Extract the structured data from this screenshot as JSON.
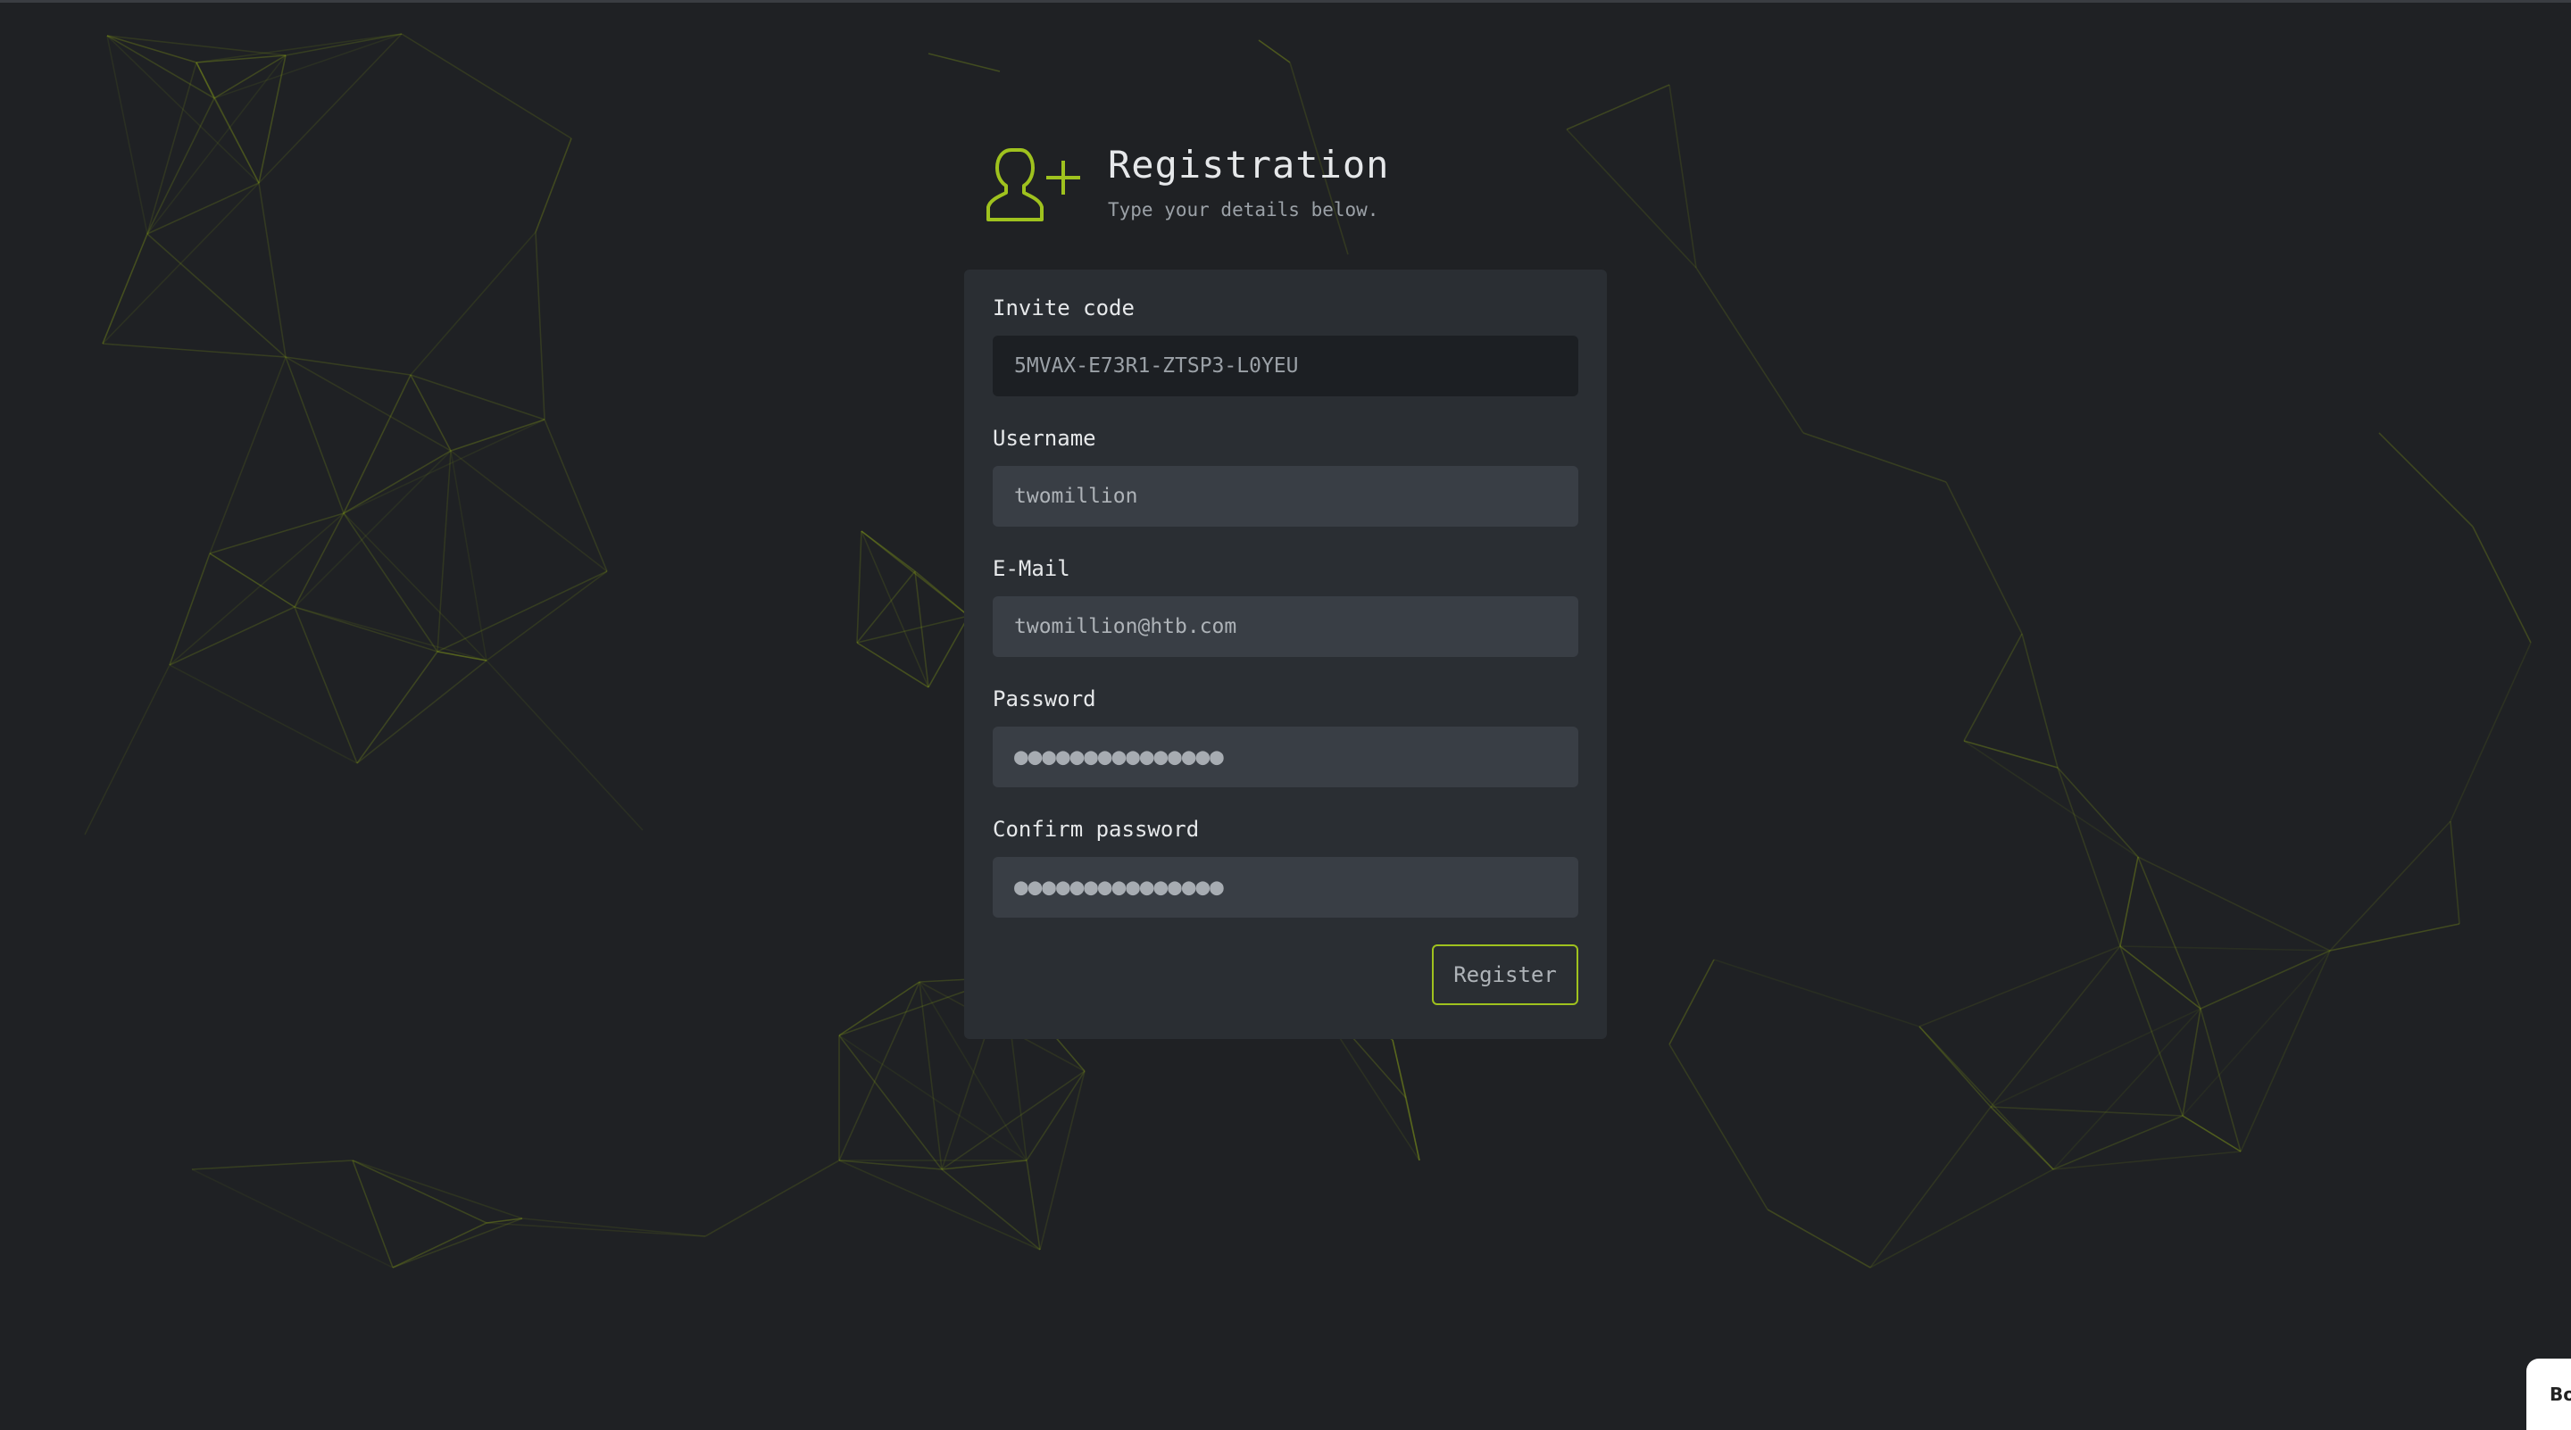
{
  "header": {
    "icon": "user-plus-icon",
    "title": "Registration",
    "subtitle": "Type your details below."
  },
  "form": {
    "invite_code": {
      "label": "Invite code",
      "value": "5MVAX-E73R1-ZTSP3-L0YEU"
    },
    "username": {
      "label": "Username",
      "value": "twomillion"
    },
    "email": {
      "label": "E-Mail",
      "value": "twomillion@htb.com"
    },
    "password": {
      "label": "Password",
      "value": "●●●●●●●●●●●●●●●"
    },
    "confirm_password": {
      "label": "Confirm password",
      "value": "●●●●●●●●●●●●●●●"
    },
    "submit_label": "Register"
  },
  "corner_widget": {
    "label": "Bo"
  },
  "colors": {
    "background": "#1f2124",
    "card": "#2a2e33",
    "input": "#393e45",
    "input_readonly": "#1c1f23",
    "accent": "#9fc21e",
    "network_lines": "#8aa318"
  }
}
